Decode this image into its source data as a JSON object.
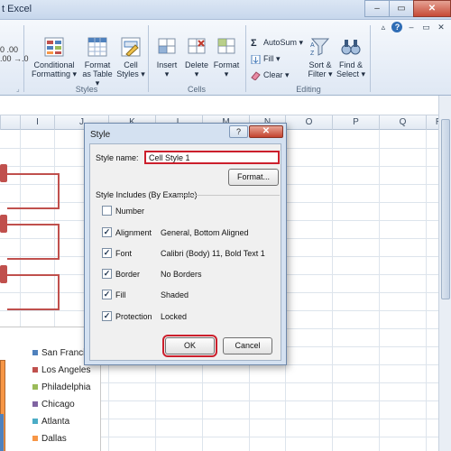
{
  "window": {
    "title": "t Excel",
    "controls": {
      "minimize": "–",
      "maximize": "▭",
      "close": "✕"
    }
  },
  "ribbon": {
    "right_controls": {
      "minimize": "▵",
      "help": "?",
      "window_min": "–",
      "window_restore": "▭",
      "window_close": "✕"
    },
    "left_stub": {
      "line1": "0 .00",
      "line2": ".00 →.0"
    },
    "groups": [
      {
        "name": "Styles",
        "buttons": [
          {
            "label": "Conditional\nFormatting ▾",
            "icon": "conditional-formatting-icon"
          },
          {
            "label": "Format\nas Table ▾",
            "icon": "format-as-table-icon"
          },
          {
            "label": "Cell\nStyles ▾",
            "icon": "cell-styles-icon"
          }
        ]
      },
      {
        "name": "Cells",
        "buttons": [
          {
            "label": "Insert\n▾",
            "icon": "insert-cells-icon"
          },
          {
            "label": "Delete\n▾",
            "icon": "delete-cells-icon"
          },
          {
            "label": "Format\n▾",
            "icon": "format-cells-icon"
          }
        ]
      },
      {
        "name": "Editing",
        "small": [
          {
            "label": "AutoSum ▾",
            "icon": "sigma-icon"
          },
          {
            "label": "Fill ▾",
            "icon": "fill-down-icon"
          },
          {
            "label": "Clear ▾",
            "icon": "eraser-icon"
          }
        ],
        "buttons": [
          {
            "label": "Sort &\nFilter ▾",
            "icon": "sort-filter-icon"
          },
          {
            "label": "Find &\nSelect ▾",
            "icon": "binoculars-icon"
          }
        ]
      }
    ],
    "launcher_glyph": "⌟"
  },
  "columns": [
    "I",
    "J",
    "K",
    "L",
    "M",
    "N",
    "O",
    "P",
    "Q",
    "R"
  ],
  "dialog": {
    "title": "Style",
    "style_name_label": "Style name:",
    "style_name_value": "Cell Style 1",
    "format_button": "Format...",
    "includes_label": "Style Includes (By Example)",
    "items": [
      {
        "label": "Number",
        "checked": false,
        "value": ""
      },
      {
        "label": "Alignment",
        "checked": true,
        "value": "General, Bottom Aligned"
      },
      {
        "label": "Font",
        "checked": true,
        "value": "Calibri (Body) 11, Bold Text 1"
      },
      {
        "label": "Border",
        "checked": true,
        "value": "No Borders"
      },
      {
        "label": "Fill",
        "checked": true,
        "value": "Shaded"
      },
      {
        "label": "Protection",
        "checked": true,
        "value": "Locked"
      }
    ],
    "ok_button": "OK",
    "cancel_button": "Cancel",
    "help_glyph": "?",
    "close_glyph": "✕"
  },
  "chart_legend": [
    {
      "label": "San Francisco",
      "color": "#4f81bd"
    },
    {
      "label": "Los Angeles",
      "color": "#c0504d"
    },
    {
      "label": "Philadelphia",
      "color": "#9bbb59"
    },
    {
      "label": "Chicago",
      "color": "#8064a2"
    },
    {
      "label": "Atlanta",
      "color": "#4bacc6"
    },
    {
      "label": "Dallas",
      "color": "#f79646"
    }
  ],
  "colors": {
    "highlight": "#cc1f2c",
    "org_shape": "#c0504d"
  }
}
